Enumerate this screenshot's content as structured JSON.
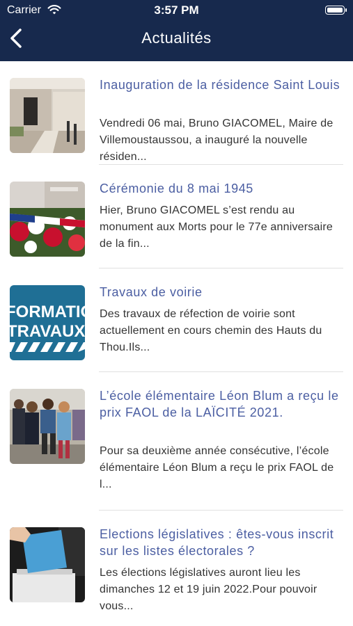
{
  "status_bar": {
    "carrier": "Carrier",
    "time": "3:57 PM"
  },
  "header": {
    "title": "Actualités"
  },
  "articles": [
    {
      "title": "Inauguration de la résidence Saint Louis",
      "excerpt": "Vendredi 06 mai, Bruno GIACOMEL, Maire de Villemoustaussou, a inauguré la nouvelle résiden..."
    },
    {
      "title": "Cérémonie du 8 mai 1945",
      "excerpt": "Hier, Bruno GIACOMEL s’est rendu au monument aux Morts pour le 77e anniversaire de la fin..."
    },
    {
      "title": "Travaux de voirie",
      "excerpt": "Des travaux de réfection de voirie sont actuellement en cours chemin des Hauts du Thou.Ils...",
      "thumb_text": [
        "FORMATIO",
        "TRAVAUX"
      ]
    },
    {
      "title": "L’école élémentaire Léon Blum a reçu le prix FAOL de la LAÏCITÉ 2021.",
      "excerpt": "Pour sa deuxième année consécutive, l’école élémentaire Léon Blum a reçu le prix FAOL de l..."
    },
    {
      "title": "Elections législatives : êtes-vous inscrit sur les listes électorales ?",
      "excerpt": "Les élections législatives auront lieu les dimanches 12 et 19 juin 2022.Pour pouvoir vous..."
    }
  ],
  "colors": {
    "header_bg": "#17294d",
    "title_link": "#4b5ea2",
    "body_text": "#333333"
  }
}
